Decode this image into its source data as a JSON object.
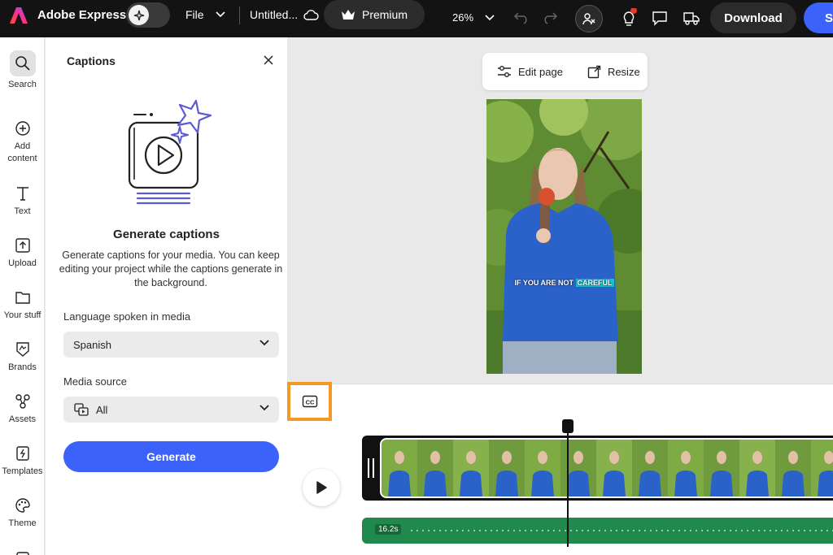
{
  "header": {
    "app_name": "Adobe Express",
    "file_label": "File",
    "doc_title": "Untitled...",
    "premium_label": "Premium",
    "zoom": "26%",
    "download_label": "Download",
    "share_label": "Sh"
  },
  "rail": {
    "items": [
      {
        "label": "Search",
        "icon": "search-icon"
      },
      {
        "label": "Add content",
        "icon": "plus-circle-icon"
      },
      {
        "label": "Text",
        "icon": "text-icon"
      },
      {
        "label": "Upload",
        "icon": "upload-icon"
      },
      {
        "label": "Your stuff",
        "icon": "folder-icon"
      },
      {
        "label": "Brands",
        "icon": "brand-icon"
      },
      {
        "label": "Assets",
        "icon": "assets-icon"
      },
      {
        "label": "Templates",
        "icon": "templates-icon"
      },
      {
        "label": "Theme",
        "icon": "palette-icon"
      }
    ]
  },
  "panel": {
    "title": "Captions",
    "heading": "Generate captions",
    "description": "Generate captions for your media. You can keep editing your project while the captions generate in the background.",
    "language_label": "Language spoken in media",
    "language_value": "Spanish",
    "source_label": "Media source",
    "source_value": "All",
    "generate_label": "Generate"
  },
  "canvas": {
    "edit_page_label": "Edit page",
    "resize_label": "Resize",
    "caption_text": "IF YOU ARE NOT",
    "caption_highlight": "CAREFUL"
  },
  "timeline": {
    "audio_duration": "16.2s"
  },
  "colors": {
    "accent": "#3b63fb",
    "highlight": "#f19a26",
    "audio_track": "#20894c"
  }
}
